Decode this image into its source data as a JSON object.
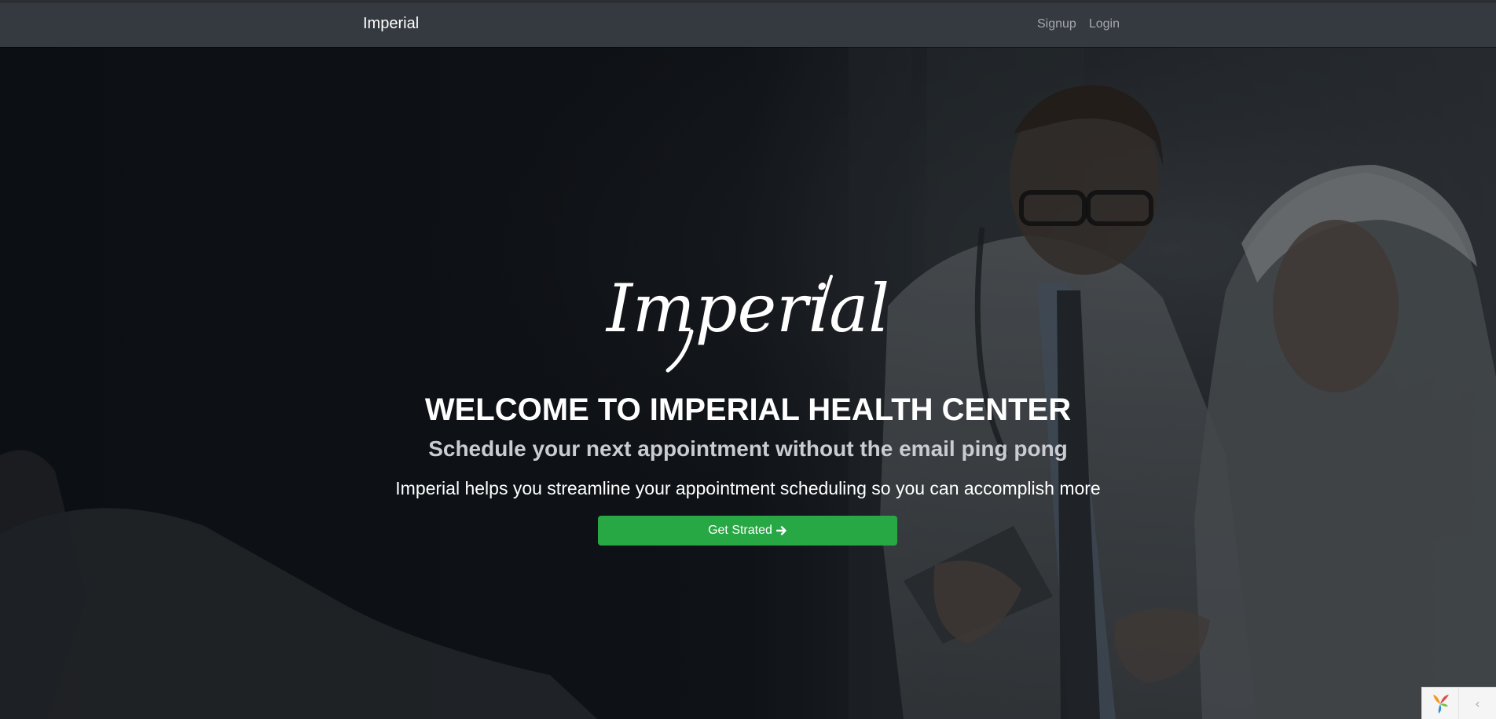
{
  "navbar": {
    "brand": "Imperial",
    "links": [
      {
        "label": "Signup"
      },
      {
        "label": "Login"
      }
    ]
  },
  "hero": {
    "logo_text": "Imperial",
    "headline": "WELCOME TO IMPERIAL HEALTH CENTER",
    "subheadline": "Schedule your next appointment without the email ping pong",
    "tagline": "Imperial helps you streamline your appointment scheduling so you can accomplish more",
    "cta_label": "Get Strated",
    "cta_icon": "arrow-right-icon"
  },
  "debug_toolbar": {
    "logo_icon": "yii-logo-icon",
    "toggle_icon": "chevron-left-icon",
    "toggle_glyph": "‹"
  },
  "colors": {
    "navbar_bg": "#343a40",
    "nav_link": "rgba(255,255,255,0.55)",
    "cta_green": "#28a745",
    "text_white": "#ffffff"
  }
}
